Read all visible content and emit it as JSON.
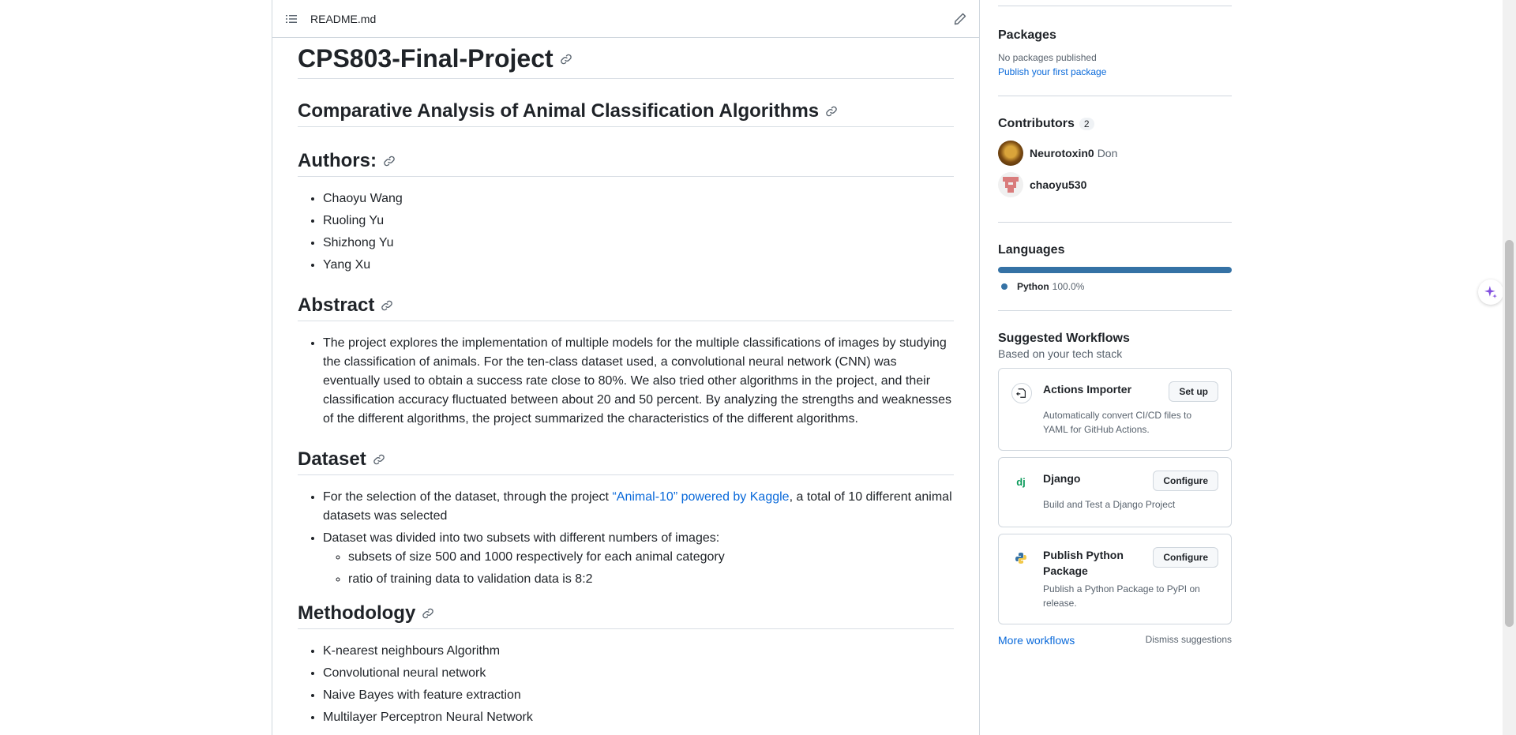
{
  "readme": {
    "file_name": "README.md",
    "title": "CPS803-Final-Project",
    "subtitle": "Comparative Analysis of Animal Classification Algorithms",
    "authors_heading": "Authors:",
    "authors": [
      "Chaoyu Wang",
      "Ruoling Yu",
      "Shizhong Yu",
      "Yang Xu"
    ],
    "abstract_heading": "Abstract",
    "abstract_text": "The project explores the implementation of multiple models for the multiple classifications of images by studying the classification of animals. For the ten-class dataset used, a convolutional neural network (CNN) was eventually used to obtain a success rate close to 80%. We also tried other algorithms in the project, and their classification accuracy fluctuated between about 20 and 50 percent. By analyzing the strengths and weaknesses of the different algorithms, the project summarized the characteristics of the different algorithms.",
    "dataset_heading": "Dataset",
    "dataset_item1_before": "For the selection of the dataset, through the project ",
    "dataset_item1_link": "“Animal-10” powered by Kaggle",
    "dataset_item1_after": ", a total of 10 different animal datasets was selected",
    "dataset_item2": "Dataset was divided into two subsets with different numbers of images:",
    "dataset_subitems": [
      "subsets of size 500 and 1000 respectively for each animal category",
      "ratio of training data to validation data is 8:2"
    ],
    "methodology_heading": "Methodology",
    "methodology": [
      "K-nearest neighbours Algorithm",
      "Convolutional neural network",
      "Naive Bayes with feature extraction",
      "Multilayer Perceptron Neural Network"
    ]
  },
  "sidebar": {
    "packages": {
      "title": "Packages",
      "empty": "No packages published",
      "link": "Publish your first package"
    },
    "contributors": {
      "title": "Contributors",
      "count": "2",
      "list": [
        {
          "login": "Neurotoxin0",
          "name": "Don"
        },
        {
          "login": "chaoyu530",
          "name": ""
        }
      ]
    },
    "languages": {
      "title": "Languages",
      "items": [
        {
          "name": "Python",
          "percent": "100.0%",
          "color": "#3572A5"
        }
      ]
    },
    "workflows": {
      "title": "Suggested Workflows",
      "subtitle": "Based on your tech stack",
      "cards": [
        {
          "title": "Actions Importer",
          "button": "Set up",
          "desc": "Automatically convert CI/CD files to YAML for GitHub Actions.",
          "icon": "actions-importer-icon"
        },
        {
          "title": "Django",
          "button": "Configure",
          "desc": "Build and Test a Django Project",
          "icon": "django-icon"
        },
        {
          "title": "Publish Python Package",
          "button": "Configure",
          "desc": "Publish a Python Package to PyPI on release.",
          "icon": "python-icon"
        }
      ],
      "more": "More workflows",
      "dismiss": "Dismiss suggestions"
    }
  }
}
